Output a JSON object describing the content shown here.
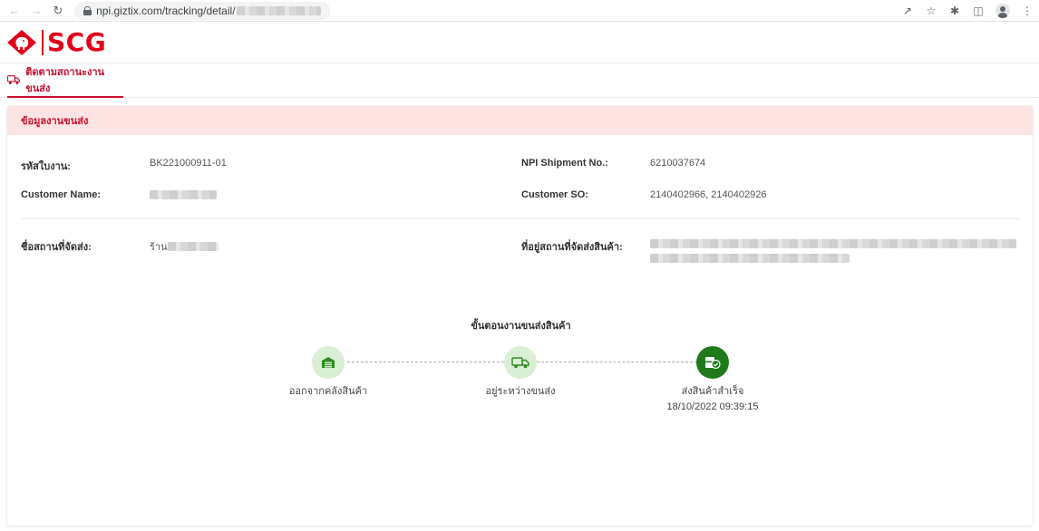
{
  "browser": {
    "url_visible": "npi.giztix.com/tracking/detail/"
  },
  "brand": {
    "logo_text": "SCG",
    "brand_color": "#e1001a"
  },
  "tabs": [
    {
      "label": "ติดตามสถานะงานขนส่ง",
      "active": true
    }
  ],
  "card": {
    "title": "ข้อมูลงานขนส่ง",
    "fields": {
      "job_no_label": "รหัสใบงาน:",
      "job_no_value": "BK221000911-01",
      "npi_label": "NPI Shipment No.:",
      "npi_value": "6210037674",
      "customer_name_label": "Customer Name:",
      "customer_so_label": "Customer SO:",
      "customer_so_value": "2140402966, 2140402926",
      "place_label": "ชื่อสถานที่จัดส่ง:",
      "place_value_prefix": "ร้าน",
      "address_label": "ที่อยู่สถานที่จัดส่งสินค้า:"
    }
  },
  "steps": {
    "title": "ขั้นตอนงานขนส่งสินค้า",
    "items": [
      {
        "label": "ออกจากคลังสินค้า",
        "icon": "warehouse-icon",
        "state": "done"
      },
      {
        "label": "อยู่ระหว่างขนส่ง",
        "icon": "truck-icon",
        "state": "done"
      },
      {
        "label": "ส่งสินค้าสำเร็จ",
        "time": "18/10/2022 09:39:15",
        "icon": "delivered-box-icon",
        "state": "current"
      }
    ]
  },
  "colors": {
    "accent": "#c8102e",
    "header_bg": "#fde4e3",
    "step_light": "#d9efd4",
    "step_dark": "#1e7a1a",
    "step_icon_green": "#2e8b24"
  }
}
